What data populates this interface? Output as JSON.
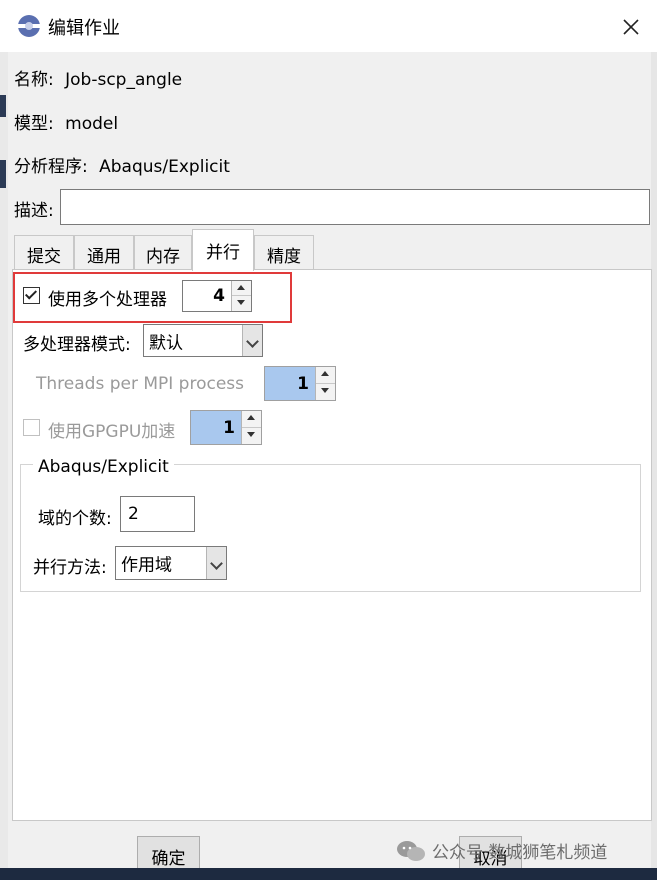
{
  "window": {
    "title": "编辑作业",
    "icon": "abaqus-app-icon",
    "close_icon": "close-icon"
  },
  "fields": {
    "name_label": "名称:",
    "name_value": "Job-scp_angle",
    "model_label": "模型:",
    "model_value": "model",
    "program_label": "分析程序:",
    "program_value": "Abaqus/Explicit",
    "description_label": "描述:",
    "description_value": ""
  },
  "tabs": [
    {
      "label": "提交",
      "active": false
    },
    {
      "label": "通用",
      "active": false
    },
    {
      "label": "内存",
      "active": false
    },
    {
      "label": "并行",
      "active": true
    },
    {
      "label": "精度",
      "active": false
    }
  ],
  "parallel": {
    "use_multi_cpu_label": "使用多个处理器",
    "use_multi_cpu_checked": true,
    "cpu_count": "4",
    "mode_label": "多处理器模式:",
    "mode_value": "默认",
    "threads_label": "Threads per MPI process",
    "threads_value": "1",
    "gpgpu_label": "使用GPGPU加速",
    "gpgpu_checked": false,
    "gpgpu_value": "1"
  },
  "explicit_group": {
    "title": "Abaqus/Explicit",
    "domains_label": "域的个数:",
    "domains_value": "2",
    "method_label": "并行方法:",
    "method_value": "作用域"
  },
  "buttons": {
    "ok_label": "确定",
    "cancel_label": "取消"
  },
  "watermark": {
    "text": "公众号·数城狮笔札频道"
  },
  "colors": {
    "highlight": "#e03a3a",
    "disabled_field": "#a9c8ee"
  }
}
